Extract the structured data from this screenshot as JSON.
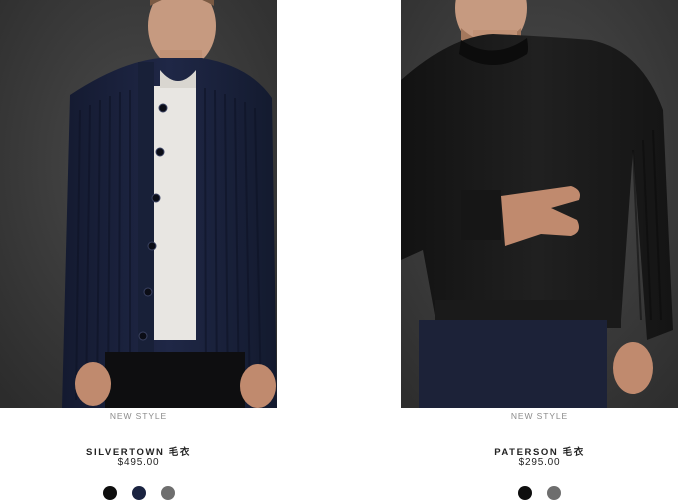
{
  "products": [
    {
      "tag": "NEW STYLE",
      "name": "SILVERTOWN 毛衣",
      "price": "$495.00",
      "swatches": [
        {
          "color": "#0e0e0e"
        },
        {
          "color": "#1a2340"
        },
        {
          "color": "#6e6e6e"
        }
      ]
    },
    {
      "tag": "NEW STYLE",
      "name": "PATERSON 毛衣",
      "price": "$295.00",
      "swatches": [
        {
          "color": "#0e0e0e"
        },
        {
          "color": "#6e6e6e"
        }
      ]
    }
  ]
}
